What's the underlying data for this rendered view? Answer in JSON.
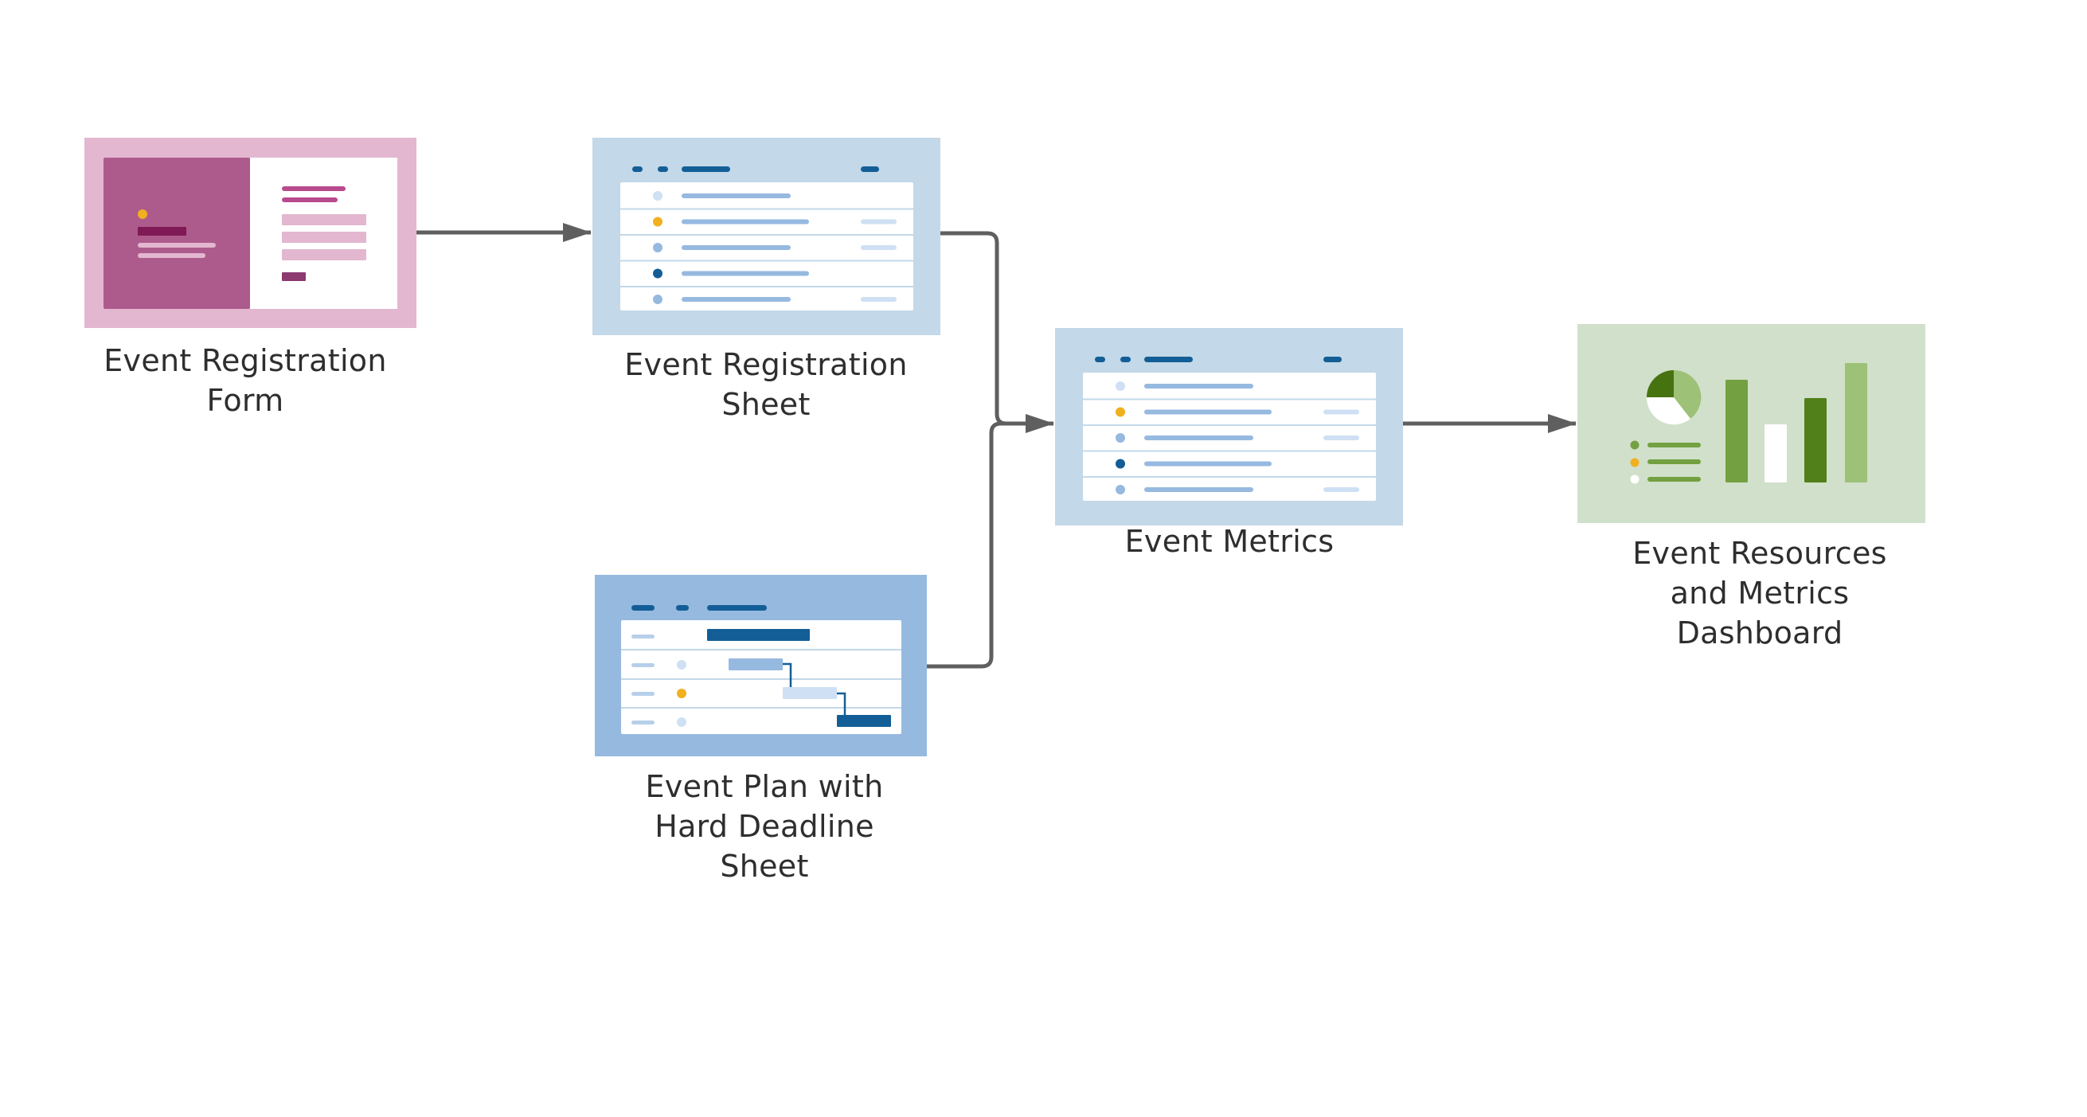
{
  "diagram": {
    "type": "workflow",
    "nodes": [
      {
        "id": "form",
        "label": "Event Registration\nForm",
        "kind": "form",
        "icon": "form-icon"
      },
      {
        "id": "reg_sheet",
        "label": "Event Registration\nSheet",
        "kind": "sheet",
        "icon": "grid-sheet-icon"
      },
      {
        "id": "plan_sheet",
        "label": "Event Plan with\nHard Deadline\nSheet",
        "kind": "gantt-sheet",
        "icon": "gantt-sheet-icon"
      },
      {
        "id": "metrics",
        "label": "Event Metrics",
        "kind": "sheet",
        "icon": "grid-sheet-icon"
      },
      {
        "id": "dashboard",
        "label": "Event Resources\nand Metrics\nDashboard",
        "kind": "dashboard",
        "icon": "dashboard-chart-icon"
      }
    ],
    "edges": [
      {
        "from": "form",
        "to": "reg_sheet"
      },
      {
        "from": "reg_sheet",
        "to": "metrics"
      },
      {
        "from": "plan_sheet",
        "to": "metrics"
      },
      {
        "from": "metrics",
        "to": "dashboard"
      }
    ]
  },
  "colors": {
    "connector": "#5f5f5f",
    "form_frame": "#e3b7d0",
    "form_panel": "#ad5b8c",
    "form_dark": "#7f1a56",
    "form_accent": "#b84a8d",
    "form_button": "#8c3a70",
    "sheet_frame": "#c3d8e8",
    "plan_frame": "#96b9e0",
    "blue_dark": "#135e96",
    "blue_mid": "#96b9e0",
    "blue_light": "#cfe0f4",
    "amber": "#f0b020",
    "dash_frame": "#d1e0ca",
    "green_dark": "#46730f",
    "green_mid": "#73a041",
    "green_deep": "#517f1a",
    "green_light": "#9dc177",
    "white": "#ffffff",
    "text": "#2e2e2e"
  }
}
